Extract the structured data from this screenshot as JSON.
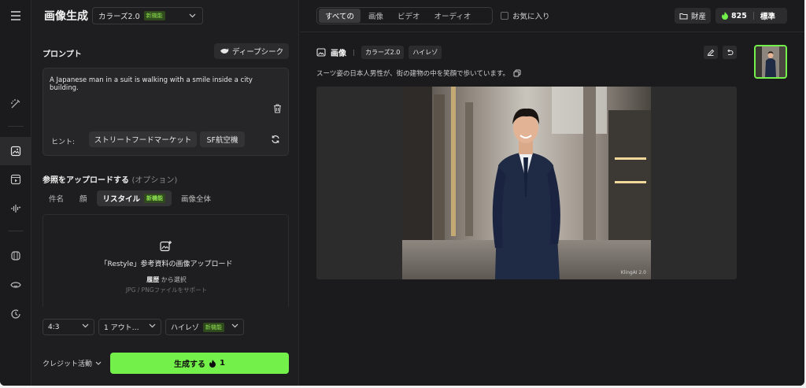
{
  "header": {
    "title": "画像生成",
    "model_select": {
      "value": "カラーズ2.0",
      "badge": "新機能"
    }
  },
  "prompt": {
    "section_label": "プロンプト",
    "deep_seek_label": "ディープシーク",
    "text": "A Japanese man in a suit is walking with a smile inside a city building.",
    "hint_label": "ヒント:",
    "hints": [
      "ストリートフードマーケット",
      "SF航空機"
    ]
  },
  "reference": {
    "section_label": "参照をアップロードする",
    "optional_label": "(オプション)",
    "tabs": [
      {
        "label": "件名"
      },
      {
        "label": "顔"
      },
      {
        "label": "リスタイル",
        "badge": "新機能"
      },
      {
        "label": "画像全体"
      }
    ],
    "upload": {
      "title": "「Restyle」参考資料の画像アップロード",
      "history_label": "履歴",
      "history_suffix": "から選択",
      "note": "JPG / PNGファイルをサポート"
    }
  },
  "settings": {
    "aspect_ratio": "4:3",
    "outputs": "1 アウト…",
    "quality": "ハイレゾ",
    "quality_badge": "新機能"
  },
  "footer": {
    "credit_label": "クレジット活動",
    "generate_label": "生成する",
    "generate_cost": "1"
  },
  "topbar": {
    "filters": [
      "すべての",
      "画像",
      "ビデオ",
      "オーディオ"
    ],
    "favorites_label": "お気に入り",
    "assets_label": "財産",
    "credits": "825",
    "plan": "標準"
  },
  "result": {
    "type_label": "画像",
    "tags": [
      "カラーズ2.0",
      "ハイレゾ"
    ],
    "description": "スーツ姿の日本人男性が、街の建物の中を笑顔で歩いています。",
    "watermark": "KlingAI 2.0"
  },
  "colors": {
    "accent": "#74f04a",
    "background": "#1b1b1d",
    "panel": "#1e1e20"
  }
}
